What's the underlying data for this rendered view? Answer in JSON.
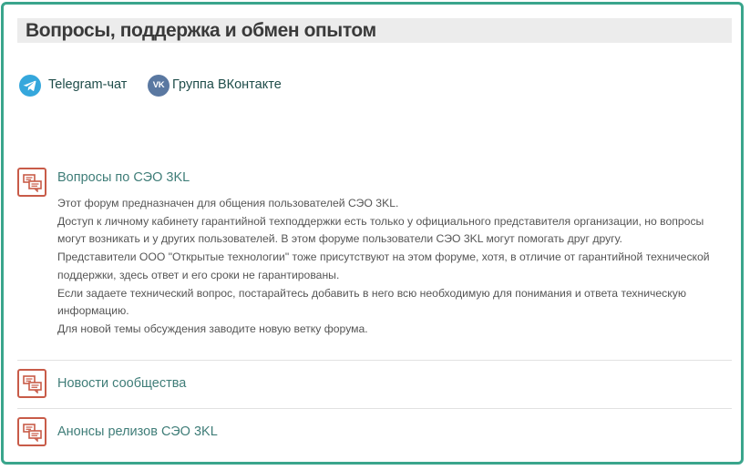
{
  "section": {
    "title": "Вопросы, поддержка и обмен опытом"
  },
  "links": [
    {
      "label": "Telegram-чат",
      "icon": "telegram-icon"
    },
    {
      "label": "Группа ВКонтакте",
      "icon": "vk-icon"
    }
  ],
  "forums": [
    {
      "title": "Вопросы по СЭО 3KL",
      "icon": "forum-icon",
      "description": [
        "Этот форум предназначен для общения пользователей СЭО 3KL.",
        "Доступ к личному кабинету гарантийной техподдержки есть только у официального представителя организации, но вопросы могут возникать и у других пользователей. В этом форуме пользователи СЭО 3KL могут помогать друг другу.",
        "Представители ООО \"Открытые технологии\" тоже присутствуют на этом форуме, хотя, в отличие от гарантийной технической поддержки, здесь ответ и его сроки не гарантированы.",
        "Если задаете технический вопрос, постарайтесь добавить в него всю необходимую для понимания и ответа техническую информацию.",
        "Для новой темы обсуждения заводите новую ветку форума."
      ]
    },
    {
      "title": "Новости сообщества",
      "icon": "forum-icon"
    },
    {
      "title": "Анонсы релизов СЭО 3KL",
      "icon": "forum-icon"
    }
  ],
  "colors": {
    "border": "#3aa58c",
    "link": "#3f7d78",
    "icon_accent": "#c85b48",
    "telegram": "#35a7dc",
    "vk": "#5a78a1"
  }
}
